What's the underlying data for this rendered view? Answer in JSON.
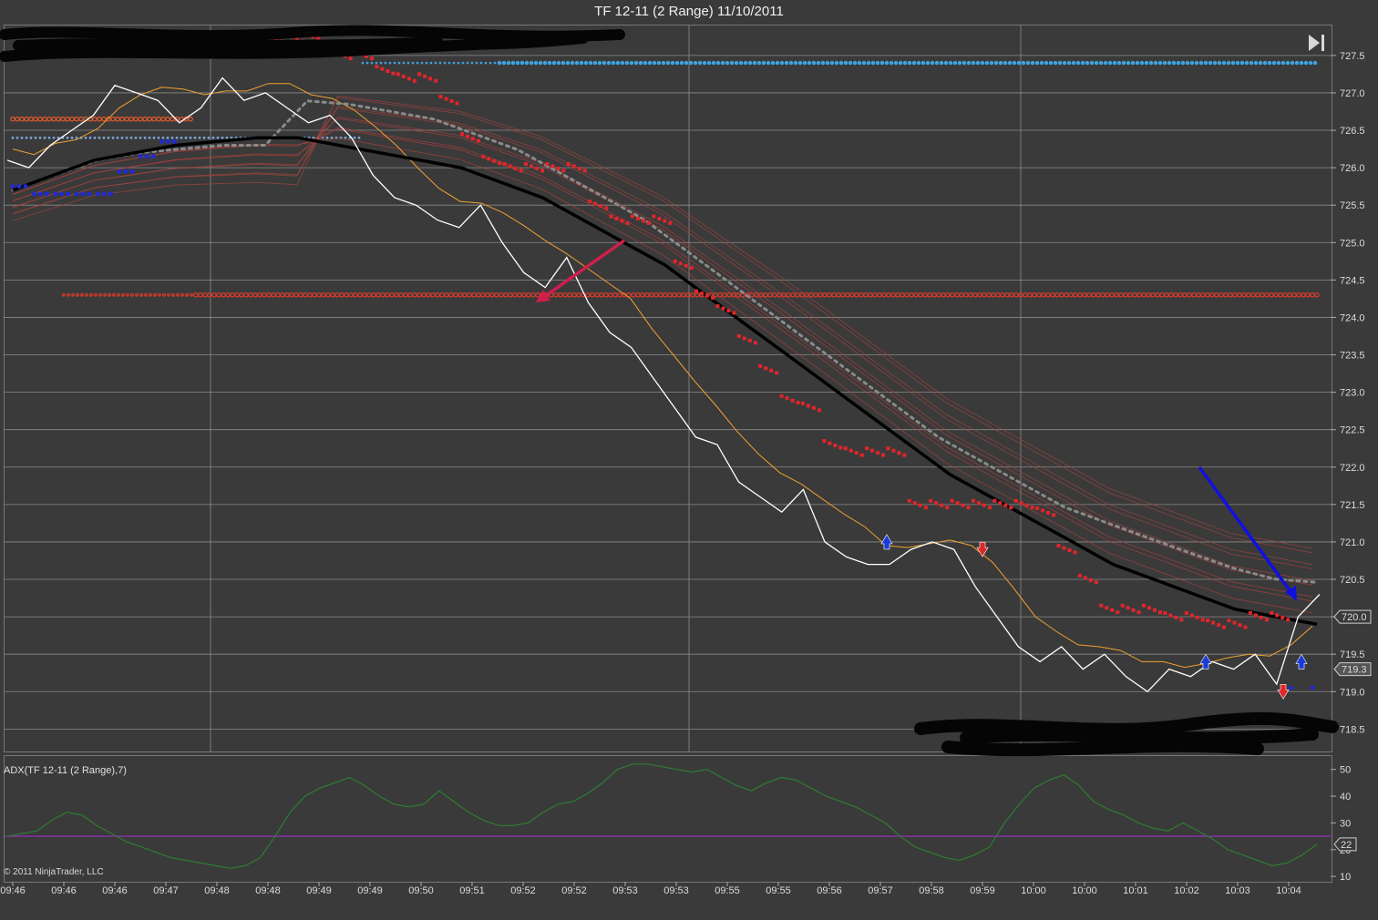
{
  "window": {
    "title": "TF 12-11 (2 Range)  11/10/2011"
  },
  "adx": {
    "label": "ADX(TF 12-11 (2 Range),7)"
  },
  "copyright": "© 2011 NinjaTrader, LLC",
  "nav": {
    "icon": "skip-to-end-icon"
  },
  "colors": {
    "background": "#3a3a3a",
    "price": "#ffffff",
    "sma_black": "#000000",
    "dotted_ma": "#8a8a8a",
    "red_stop": "#e0262b",
    "blue_stop": "#1f2bd6",
    "resistance_line": "#3ea4e0",
    "support_line": "#e03a2a",
    "adx": "#2e7d32",
    "adx_threshold": "#9b2fc9",
    "annotation_red": "#d11e4c",
    "annotation_blue": "#1010e0"
  },
  "chart_data": [
    {
      "type": "line",
      "title": "TF 12-11 (2 Range)  11/10/2011",
      "ylim": [
        718.2,
        727.9
      ],
      "y_ticks": [
        "727.5",
        "727.0",
        "726.5",
        "726.0",
        "725.5",
        "725.0",
        "724.5",
        "724.0",
        "723.5",
        "723.0",
        "722.5",
        "722.0",
        "721.5",
        "721.0",
        "720.5",
        "720.0",
        "719.5",
        "719.0",
        "718.5"
      ],
      "x_ticks": [
        "09:46",
        "09:46",
        "09:46",
        "09:47",
        "09:48",
        "09:48",
        "09:49",
        "09:49",
        "09:50",
        "09:51",
        "09:52",
        "09:52",
        "09:53",
        "09:53",
        "09:55",
        "09:55",
        "09:56",
        "09:57",
        "09:58",
        "09:59",
        "10:00",
        "10:00",
        "10:01",
        "10:02",
        "10:03",
        "10:04"
      ],
      "price_markers": {
        "last": "720.0",
        "secondary": "719.3"
      },
      "series": [
        {
          "values": [
            726.1,
            726.0,
            726.3,
            726.5,
            726.7,
            727.1,
            727.0,
            726.9,
            726.6,
            726.8,
            727.2,
            726.9,
            727.0,
            726.8,
            726.6,
            726.7,
            726.4,
            725.9,
            725.6,
            725.5,
            725.3,
            725.2,
            725.5,
            725.0,
            724.6,
            724.4,
            724.8,
            724.2,
            723.8,
            723.6,
            723.2,
            722.8,
            722.4,
            722.3,
            721.8,
            721.6,
            721.4,
            721.7,
            721.0,
            720.8,
            720.7,
            720.7,
            720.9,
            721.0,
            720.9,
            720.4,
            720.0,
            719.6,
            719.4,
            719.6,
            719.3,
            719.5,
            719.2,
            719.0,
            719.3,
            719.2,
            719.4,
            719.3,
            719.5,
            719.1,
            720.0,
            720.3
          ]
        },
        {
          "values": [
            725.7,
            725.9,
            726.1,
            726.2,
            726.3,
            726.35,
            726.4,
            726.4,
            726.3,
            726.2,
            726.1,
            726.0,
            725.8,
            725.6,
            725.3,
            725.0,
            724.7,
            724.3,
            723.9,
            723.5,
            723.1,
            722.7,
            722.3,
            721.9,
            721.6,
            721.3,
            721.0,
            720.7,
            720.5,
            720.3,
            720.1,
            720.0,
            719.9
          ]
        },
        {
          "values": [
            725.7,
            725.9,
            726.1,
            726.2,
            726.25,
            726.3,
            726.3,
            726.25,
            726.2,
            726.1,
            726.0,
            725.8,
            725.6,
            725.3,
            725.0,
            724.7,
            724.3,
            723.9,
            723.5,
            723.1,
            722.7,
            722.3,
            721.9,
            721.6,
            721.3,
            721.0,
            720.8,
            720.6,
            720.4,
            720.2,
            720.05,
            720.0
          ]
        }
      ],
      "horizontal_lines": [
        {
          "value": 727.4
        },
        {
          "value": 724.3
        },
        {
          "value": 726.65
        },
        {
          "value": 726.4
        }
      ]
    },
    {
      "type": "line",
      "title": "ADX(TF 12-11 (2 Range),7)",
      "ylim": [
        8,
        55
      ],
      "y_ticks": [
        "50",
        "40",
        "30",
        "20",
        "10"
      ],
      "threshold": 25,
      "current_value_marker": "22",
      "series": [
        {
          "values": [
            25,
            26,
            27,
            31,
            34,
            33,
            29,
            26,
            23,
            21,
            19,
            17,
            16,
            15,
            14,
            13,
            14,
            17,
            25,
            34,
            40,
            43,
            45,
            47,
            44,
            40,
            37,
            36,
            37,
            42,
            38,
            34,
            31,
            29,
            29,
            30,
            34,
            37,
            38,
            41,
            45,
            50,
            52,
            52,
            51,
            50,
            49,
            50,
            47,
            44,
            42,
            45,
            47,
            46,
            43,
            40,
            38,
            36,
            33,
            30,
            25,
            21,
            19,
            17,
            16,
            18,
            21,
            30,
            37,
            43,
            46,
            48,
            44,
            38,
            35,
            33,
            30,
            28,
            27,
            30,
            27,
            24,
            20,
            18,
            16,
            14,
            15,
            18,
            22
          ]
        }
      ]
    }
  ]
}
